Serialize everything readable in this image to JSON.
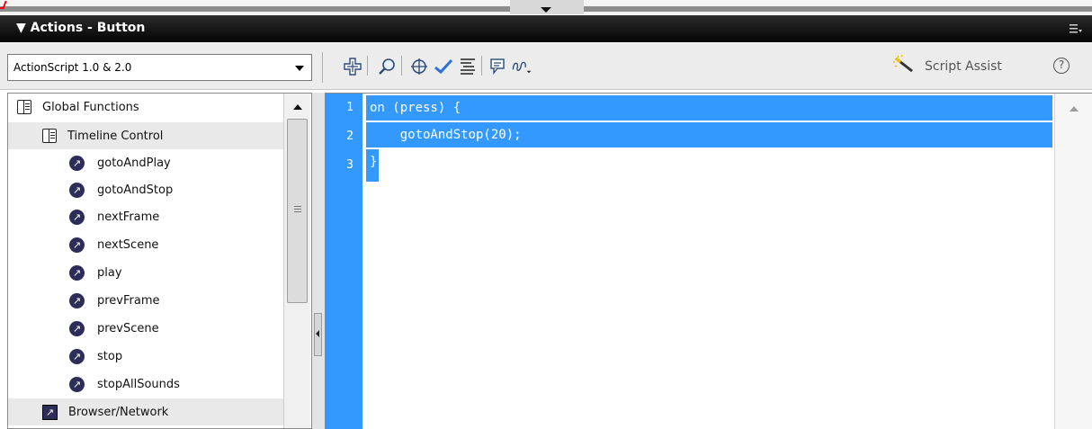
{
  "panel": {
    "title": "▼ Actions - Button",
    "menu_icon": "panel-menu-icon"
  },
  "toolbar": {
    "language_select": "ActionScript 1.0 & 2.0",
    "tools": [
      {
        "name": "add-item-icon"
      },
      {
        "name": "find-icon"
      },
      {
        "name": "insert-target-path-icon"
      },
      {
        "name": "check-syntax-icon"
      },
      {
        "name": "auto-format-icon"
      },
      {
        "name": "show-code-hint-icon"
      },
      {
        "name": "debug-options-icon"
      }
    ],
    "script_assist_label": "Script Assist",
    "help_label": "?"
  },
  "tree": {
    "items": [
      {
        "label": "Global Functions",
        "icon": "book-icon",
        "level": 0
      },
      {
        "label": "Timeline Control",
        "icon": "book-icon",
        "level": 1
      },
      {
        "label": "gotoAndPlay",
        "icon": "function-icon",
        "level": 2
      },
      {
        "label": "gotoAndStop",
        "icon": "function-icon",
        "level": 2
      },
      {
        "label": "nextFrame",
        "icon": "function-icon",
        "level": 2
      },
      {
        "label": "nextScene",
        "icon": "function-icon",
        "level": 2
      },
      {
        "label": "play",
        "icon": "function-icon",
        "level": 2
      },
      {
        "label": "prevFrame",
        "icon": "function-icon",
        "level": 2
      },
      {
        "label": "prevScene",
        "icon": "function-icon",
        "level": 2
      },
      {
        "label": "stop",
        "icon": "function-icon",
        "level": 2
      },
      {
        "label": "stopAllSounds",
        "icon": "function-icon",
        "level": 2
      },
      {
        "label": "Browser/Network",
        "icon": "category-icon",
        "level": 1
      }
    ]
  },
  "editor": {
    "lines": [
      {
        "number": "1",
        "code": "on (press) {"
      },
      {
        "number": "2",
        "code": "    gotoAndStop(20);"
      },
      {
        "number": "3",
        "code": "}"
      }
    ],
    "selection_color": "#3399ff"
  },
  "colors": {
    "title_bar": "#111111",
    "selection": "#3399ff",
    "function_icon": "#2d2d5a"
  }
}
